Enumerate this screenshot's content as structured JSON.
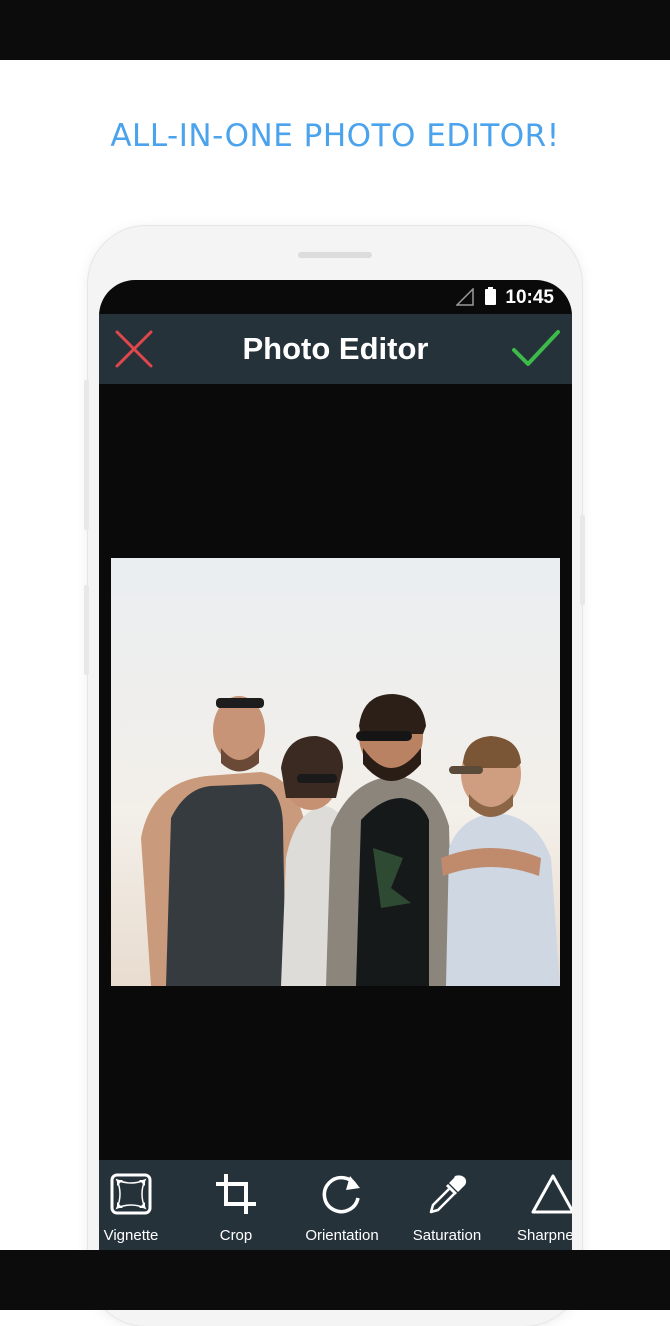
{
  "promo": {
    "headline": "ALL-IN-ONE PHOTO EDITOR!"
  },
  "status_bar": {
    "time": "10:45"
  },
  "app_bar": {
    "title": "Photo Editor"
  },
  "colors": {
    "accent_blue": "#4aa3ec",
    "app_bar_bg": "#26323a",
    "close_red": "#e0474c",
    "confirm_green": "#3dbb4a"
  },
  "toolbar": {
    "items": [
      {
        "label": "Vignette",
        "icon": "vignette-icon"
      },
      {
        "label": "Crop",
        "icon": "crop-icon"
      },
      {
        "label": "Orientation",
        "icon": "rotate-icon"
      },
      {
        "label": "Saturation",
        "icon": "eyedropper-icon"
      },
      {
        "label": "Sharpne",
        "icon": "triangle-icon"
      }
    ]
  }
}
